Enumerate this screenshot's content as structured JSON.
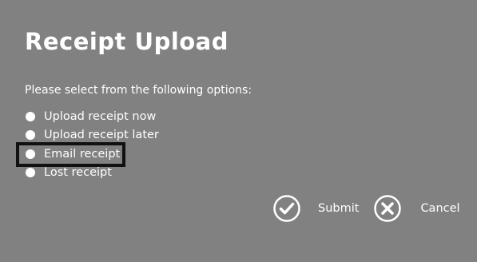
{
  "dialog": {
    "title": "Receipt Upload",
    "prompt": "Please select from the following options:",
    "options": [
      {
        "label": "Upload receipt now",
        "selected": false,
        "focused": false
      },
      {
        "label": "Upload receipt later",
        "selected": false,
        "focused": false
      },
      {
        "label": "Email receipt",
        "selected": false,
        "focused": true
      },
      {
        "label": "Lost receipt",
        "selected": false,
        "focused": false
      }
    ],
    "actions": {
      "submit_label": "Submit",
      "submit_icon": "checkmark-circle-icon",
      "cancel_label": "Cancel",
      "cancel_icon": "x-circle-icon"
    }
  },
  "colors": {
    "background": "#818181",
    "text": "#ffffff",
    "focus_outline": "#111111"
  }
}
